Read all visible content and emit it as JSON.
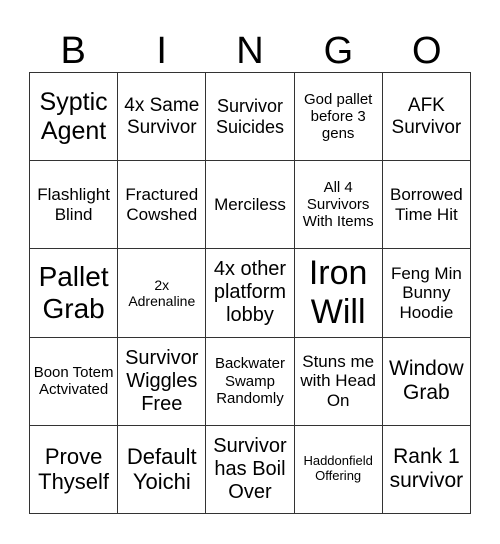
{
  "header": [
    "B",
    "I",
    "N",
    "G",
    "O"
  ],
  "rows": [
    [
      {
        "text": "Syptic Agent",
        "size": "25px"
      },
      {
        "text": "4x Same Survivor",
        "size": "19px"
      },
      {
        "text": "Survivor Suicides",
        "size": "18px"
      },
      {
        "text": "God pallet before 3 gens",
        "size": "15px"
      },
      {
        "text": "AFK Survivor",
        "size": "19px"
      }
    ],
    [
      {
        "text": "Flashlight Blind",
        "size": "17px"
      },
      {
        "text": "Fractured Cowshed",
        "size": "17px"
      },
      {
        "text": "Merciless",
        "size": "17px"
      },
      {
        "text": "All 4 Survivors With Items",
        "size": "15px"
      },
      {
        "text": "Borrowed Time Hit",
        "size": "17px"
      }
    ],
    [
      {
        "text": "Pallet Grab",
        "size": "28px"
      },
      {
        "text": "2x Adrenaline",
        "size": "14px"
      },
      {
        "text": "4x other platform lobby",
        "size": "20px"
      },
      {
        "text": "Iron Will",
        "size": "34px"
      },
      {
        "text": "Feng Min Bunny Hoodie",
        "size": "17px"
      }
    ],
    [
      {
        "text": "Boon Totem Actvivated",
        "size": "15px"
      },
      {
        "text": "Survivor Wiggles Free",
        "size": "20px"
      },
      {
        "text": "Backwater Swamp Randomly",
        "size": "15px"
      },
      {
        "text": "Stuns me with Head On",
        "size": "17px"
      },
      {
        "text": "Window Grab",
        "size": "21px"
      }
    ],
    [
      {
        "text": "Prove Thyself",
        "size": "22px"
      },
      {
        "text": "Default Yoichi",
        "size": "22px"
      },
      {
        "text": "Survivor has Boil Over",
        "size": "20px"
      },
      {
        "text": "Haddonfield Offering",
        "size": "13px"
      },
      {
        "text": "Rank 1 survivor",
        "size": "21px"
      }
    ]
  ]
}
